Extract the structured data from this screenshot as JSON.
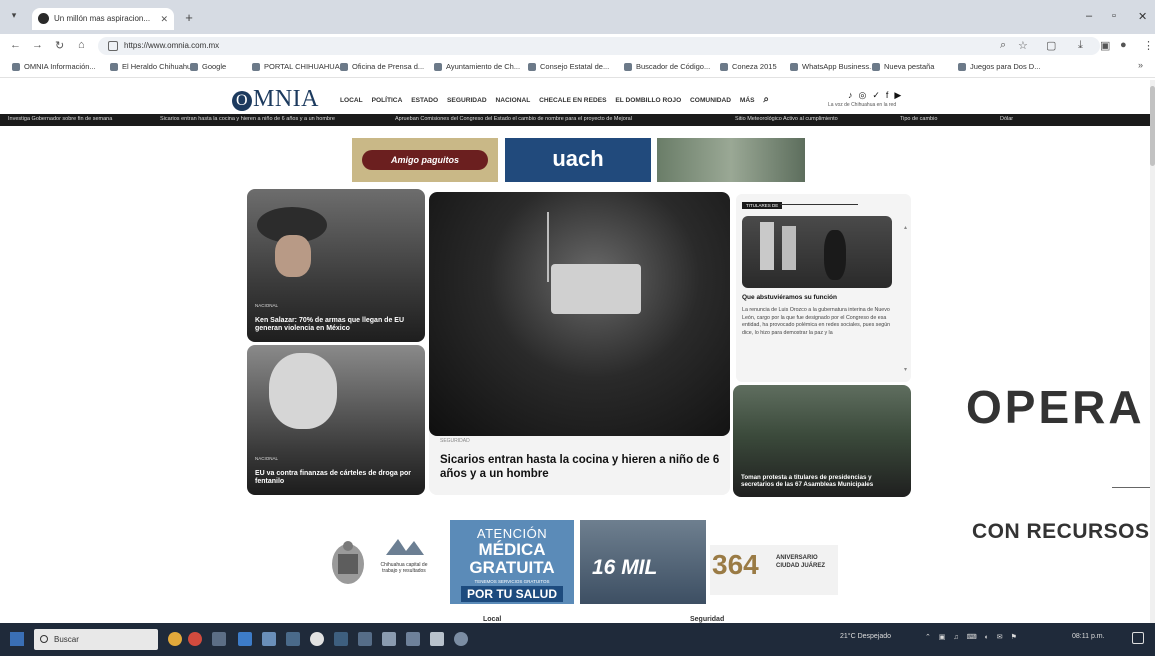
{
  "browser": {
    "tab_title": "Un millón mas aspiracion...",
    "url": "https://www.omnia.com.mx",
    "bookmarks": [
      "OMNIA Información...",
      "El Heraldo Chihuahua",
      "Google",
      "PORTAL CHIHUAHUA",
      "Oficina de Prensa d...",
      "Ayuntamiento de Ch...",
      "Consejo Estatal de...",
      "Buscador de Código...",
      "Coneza 2015",
      "WhatsApp Business...",
      "Nueva pestaña",
      "Juegos para Dos D..."
    ]
  },
  "site": {
    "logo_rest": "MNIA",
    "nav": [
      "LOCAL",
      "POLÍTICA",
      "ESTADO",
      "SEGURIDAD",
      "NACIONAL",
      "CHECALE EN REDES",
      "EL DOMBILLO ROJO",
      "COMUNIDAD",
      "MÁS"
    ],
    "tagline": "La voz de Chihuahua en la red",
    "ticker": [
      "Investiga Gobernador sobre fin de semana",
      "Sicarios entran hasta la cocina y hieren a niño de 6 años y a un hombre",
      "Aprueban Comisiones del Congreso del Estado el cambio de nombre para el proyecto de Mejoral",
      "Sitio Meteorológico Activo al cumplimiento",
      "Tipo de cambio",
      "Dólar"
    ]
  },
  "banners_top": {
    "b1": "Amigo paguitos",
    "b2": "uach"
  },
  "articles": {
    "a1": {
      "category": "NACIONAL",
      "title": "Ken Salazar: 70% de armas que llegan de EU generan violencia en México"
    },
    "a2": {
      "category": "NACIONAL",
      "title": "EU va contra finanzas de cárteles de droga por fentanilo"
    },
    "main": {
      "category": "SEGURIDAD",
      "title": "Sicarios entran hasta la cocina y hieren a niño de 6 años y a un hombre"
    },
    "side": {
      "label": "TITULARES DE",
      "title": "Que abstuviéramos su función",
      "body": "La renuncia de Luis Orozco a la gubernatura interina de Nuevo León, cargo por la que fue designado por el Congreso de esa entidad, ha provocado polémica en redes sociales, pues según dice, lo hizo para demostrar la paz y la"
    },
    "a4": {
      "title": "Toman protesta a titulares de presidencias y secretarios de las 67 Asambleas Municipales"
    }
  },
  "side_banner": {
    "line1": "OPERA",
    "line2": "CON RECURSOS"
  },
  "banners_bottom": {
    "state_text": "Chihuahua capital de trabajo y resultados",
    "med": {
      "l1": "ATENCIÓN",
      "l2": "MÉDICA",
      "l3": "GRATUITA",
      "l4": "TENEMOS SERVICIOS GRATUITOS",
      "l5": "POR TU SALUD"
    },
    "mil": "16 MIL",
    "aniv": {
      "num": "364",
      "label": "ANIVERSARIO CIUDAD JUÁREZ"
    }
  },
  "footer_peek": {
    "local": "Local",
    "seguridad": "Seguridad"
  },
  "taskbar": {
    "search": "Buscar",
    "weather": "21°C Despejado",
    "time": "08:11 p.m."
  }
}
